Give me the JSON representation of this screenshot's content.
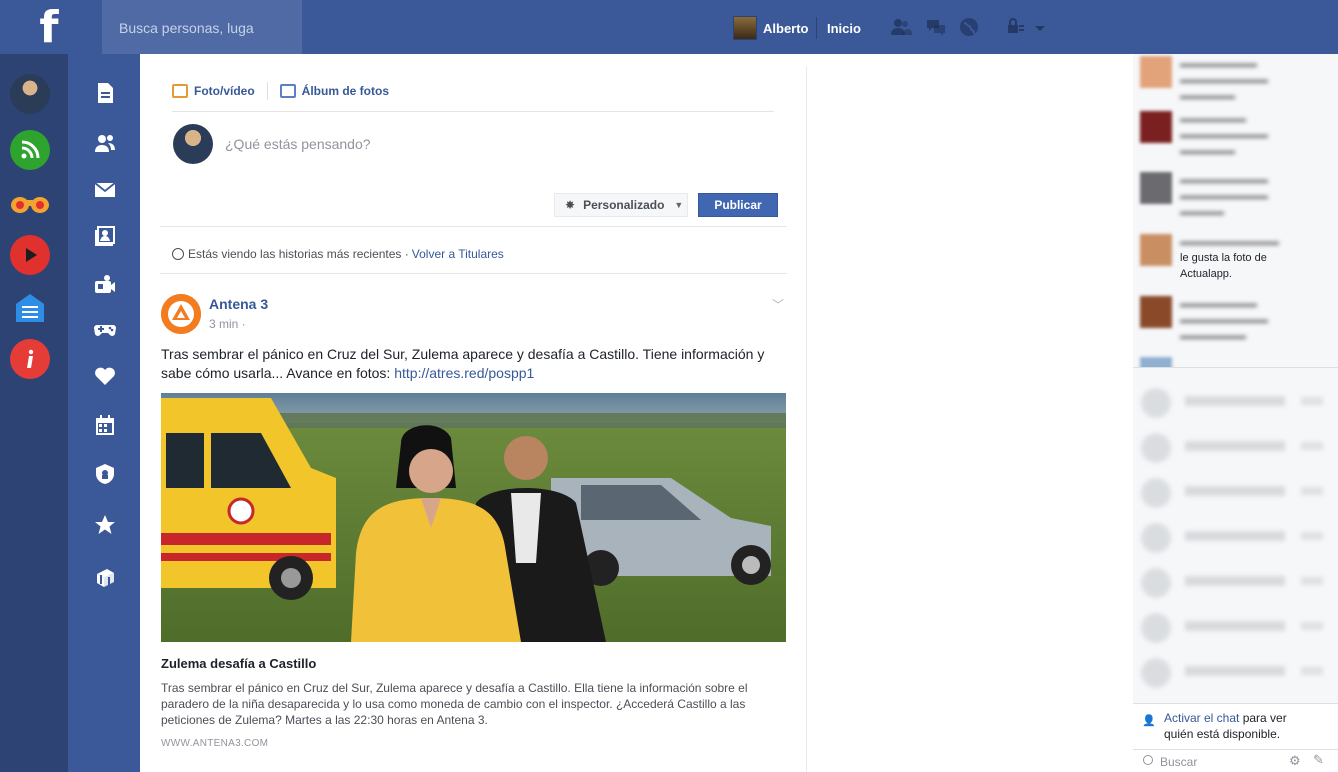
{
  "topbar": {
    "logo": "f",
    "search_placeholder": "Busca personas, luga",
    "user_name": "Alberto",
    "home_label": "Inicio"
  },
  "composer": {
    "tab_photo": "Foto/vídeo",
    "tab_album": "Álbum de fotos",
    "placeholder": "¿Qué estás pensando?",
    "privacy": "Personalizado",
    "publish": "Publicar"
  },
  "feed_notice": {
    "text": "Estás viendo las historias más recientes · ",
    "link": "Volver a Titulares"
  },
  "post": {
    "author": "Antena 3",
    "time": "3 min ·",
    "text": "Tras sembrar el pánico en Cruz del Sur, Zulema aparece y desafía a Castillo. Tiene información y sabe cómo usarla... Avance en fotos: ",
    "link": "http://atres.red/pospp1",
    "link_title": "Zulema desafía a Castillo",
    "link_description": "Tras sembrar el pánico en Cruz del Sur, Zulema aparece y desafía a Castillo. Ella tiene la información sobre el paradero de la niña desaparecida y lo usa como moneda de cambio con el inspector. ¿Accederá Castillo a las peticiones de Zulema? Martes a las 22:30 horas en Antena 3.",
    "link_domain": "WWW.ANTENA3.COM"
  },
  "ticker": {
    "visible_item": {
      "line1": "le gusta la foto de",
      "line2": "Actualapp."
    }
  },
  "chat": {
    "activate_link": "Activar el chat",
    "activate_rest_1": " para ver",
    "activate_rest_2": "quién está disponible.",
    "search_placeholder": "Buscar"
  },
  "icons": {
    "left_apps": [
      "profile-avatar",
      "rss-icon",
      "binoculars-icon",
      "play-icon",
      "home-menu-icon",
      "info-icon"
    ],
    "nav": [
      "document-icon",
      "friends-icon",
      "envelope-icon",
      "photos-icon",
      "camera-icon",
      "gamepad-icon",
      "heart-icon",
      "calendar-icon",
      "shield-icon",
      "star-icon",
      "gift-icon"
    ]
  },
  "colors": {
    "brand": "#3b5998",
    "link": "#365899",
    "publish": "#4267b2",
    "rss": "#2ea32e",
    "binoculars": "#f4a231",
    "play": "#e0312f",
    "home_menu": "#2e8ee6",
    "info": "#e63c37"
  }
}
